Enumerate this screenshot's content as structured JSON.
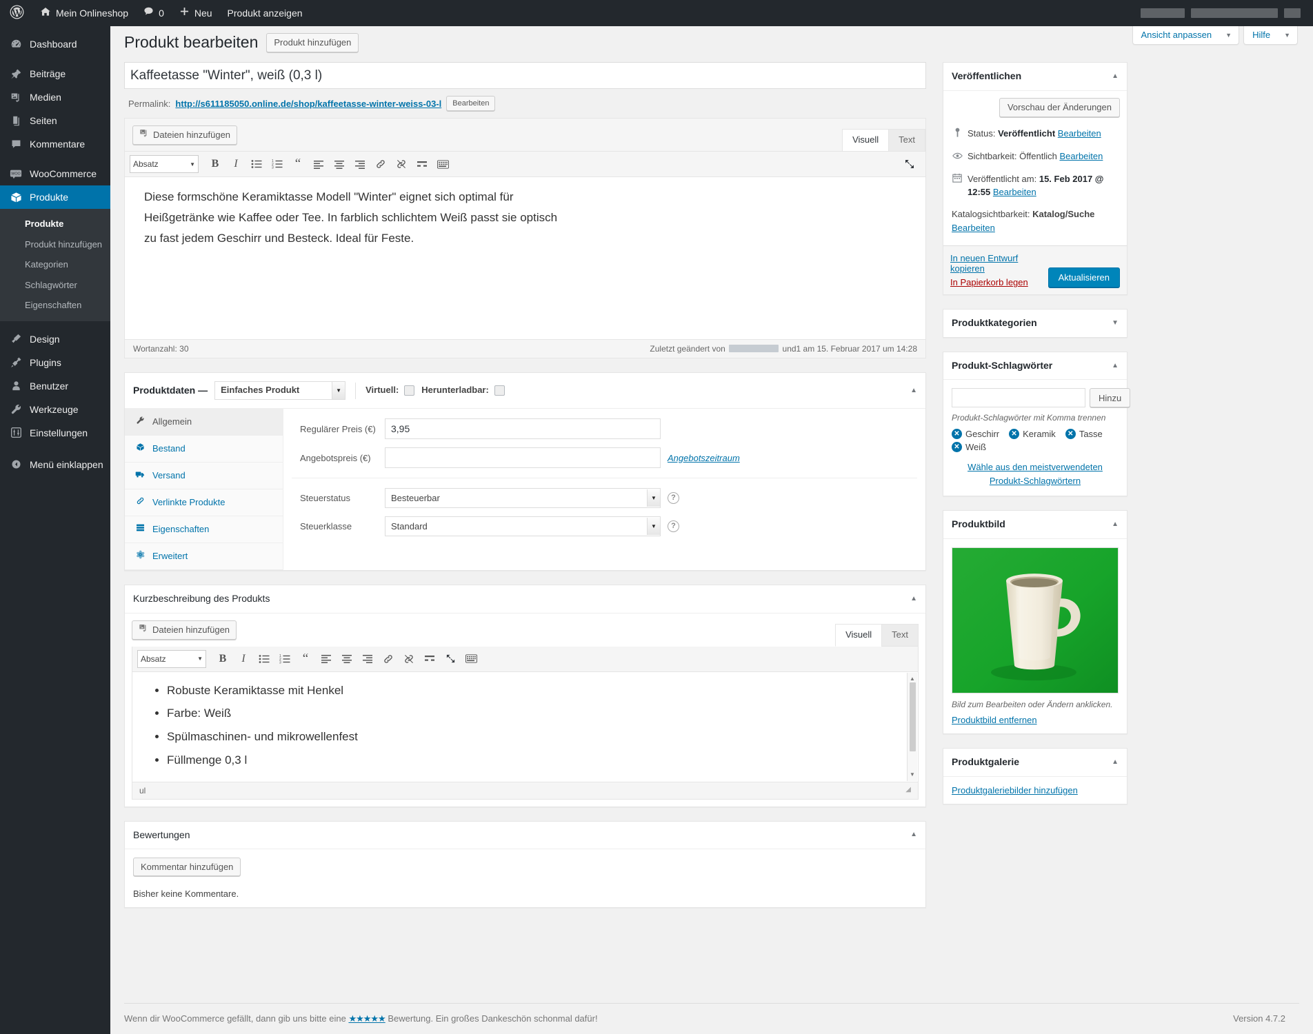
{
  "adminbar": {
    "logo_icon": "wordpress-logo-icon",
    "site_name": "Mein Onlineshop",
    "comments_count": "0",
    "new_label": "Neu",
    "view_product_label": "Produkt anzeigen"
  },
  "sidebar": {
    "items": [
      {
        "label": "Dashboard",
        "icon": "dashboard-icon",
        "current": false
      },
      {
        "label": "Beiträge",
        "icon": "pin-icon",
        "current": false
      },
      {
        "label": "Medien",
        "icon": "media-icon",
        "current": false
      },
      {
        "label": "Seiten",
        "icon": "pages-icon",
        "current": false
      },
      {
        "label": "Kommentare",
        "icon": "comment-icon",
        "current": false
      },
      {
        "label": "WooCommerce",
        "icon": "woocommerce-icon",
        "current": false
      },
      {
        "label": "Produkte",
        "icon": "products-box-icon",
        "current": true
      },
      {
        "label": "Design",
        "icon": "paintbrush-icon",
        "current": false
      },
      {
        "label": "Plugins",
        "icon": "plug-icon",
        "current": false
      },
      {
        "label": "Benutzer",
        "icon": "user-icon",
        "current": false
      },
      {
        "label": "Werkzeuge",
        "icon": "wrench-icon",
        "current": false
      },
      {
        "label": "Einstellungen",
        "icon": "settings-sliders-icon",
        "current": false
      }
    ],
    "submenu": [
      {
        "label": "Produkte",
        "current": true
      },
      {
        "label": "Produkt hinzufügen",
        "current": false
      },
      {
        "label": "Kategorien",
        "current": false
      },
      {
        "label": "Schlagwörter",
        "current": false
      },
      {
        "label": "Eigenschaften",
        "current": false
      }
    ],
    "collapse_label": "Menü einklappen"
  },
  "screen_meta": {
    "customize_label": "Ansicht anpassen",
    "help_label": "Hilfe"
  },
  "header": {
    "page_title": "Produkt bearbeiten",
    "add_new_label": "Produkt hinzufügen"
  },
  "title_field": {
    "value": "Kaffeetasse \"Winter\", weiß (0,3 l)"
  },
  "permalink": {
    "label": "Permalink:",
    "url": "http://s611185050.online.de/shop/kaffeetasse-winter-weiss-03-l",
    "edit_label": "Bearbeiten"
  },
  "editor": {
    "add_media_label": "Dateien hinzufügen",
    "tab_visual": "Visuell",
    "tab_text": "Text",
    "format_select": "Absatz",
    "content": "Diese formschöne Keramiktasse Modell \"Winter\" eignet sich optimal für Heißgetränke wie Kaffee oder Tee. In farblich schlichtem Weiß passt sie optisch zu fast jedem Geschirr und Besteck. Ideal für Feste.",
    "word_count_label": "Wortanzahl: 30",
    "last_edited_prefix": "Zuletzt geändert von",
    "last_edited_mid": "und1 am",
    "last_edited_date": "15. Februar 2017 um 14:28"
  },
  "product_data": {
    "panel_label": "Produktdaten —",
    "type_value": "Einfaches Produkt",
    "virtual_label": "Virtuell:",
    "downloadable_label": "Herunterladbar:",
    "tabs": [
      {
        "label": "Allgemein",
        "icon": "wrench-icon",
        "active": true
      },
      {
        "label": "Bestand",
        "icon": "inventory-icon",
        "active": false
      },
      {
        "label": "Versand",
        "icon": "shipping-icon",
        "active": false
      },
      {
        "label": "Verlinkte Produkte",
        "icon": "link-icon",
        "active": false
      },
      {
        "label": "Eigenschaften",
        "icon": "attributes-icon",
        "active": false
      },
      {
        "label": "Erweitert",
        "icon": "gear-icon",
        "active": false
      }
    ],
    "fields": {
      "regular_price_label": "Regulärer Preis (€)",
      "regular_price_value": "3,95",
      "sale_price_label": "Angebotspreis (€)",
      "sale_price_value": "",
      "sale_schedule_link": "Angebotszeitraum",
      "tax_status_label": "Steuerstatus",
      "tax_status_value": "Besteuerbar",
      "tax_class_label": "Steuerklasse",
      "tax_class_value": "Standard",
      "help_glyph": "?"
    }
  },
  "short_description": {
    "title": "Kurzbeschreibung des Produkts",
    "add_media_label": "Dateien hinzufügen",
    "tab_visual": "Visuell",
    "tab_text": "Text",
    "format_select": "Absatz",
    "items": [
      "Robuste Keramiktasse mit Henkel",
      "Farbe: Weiß",
      "Spülmaschinen- und mikrowellenfest",
      "Füllmenge 0,3 l"
    ],
    "path_label": "ul"
  },
  "reviews": {
    "title": "Bewertungen",
    "add_comment_label": "Kommentar hinzufügen",
    "empty_label": "Bisher keine Kommentare."
  },
  "publish_box": {
    "title": "Veröffentlichen",
    "preview_label": "Vorschau der Änderungen",
    "status_label": "Status:",
    "status_value": "Veröffentlicht",
    "status_edit": "Bearbeiten",
    "visibility_label": "Sichtbarkeit:",
    "visibility_value": "Öffentlich",
    "visibility_edit": "Bearbeiten",
    "published_label": "Veröffentlicht am:",
    "published_value": "15. Feb 2017 @ 12:55",
    "published_edit": "Bearbeiten",
    "catalog_label": "Katalogsichtbarkeit:",
    "catalog_value": "Katalog/Suche",
    "catalog_edit": "Bearbeiten",
    "copy_draft_label": "In neuen Entwurf kopieren",
    "trash_label": "In Papierkorb legen",
    "update_label": "Aktualisieren"
  },
  "categories_box": {
    "title": "Produktkategorien"
  },
  "tags_box": {
    "title": "Produkt-Schlagwörter",
    "input_value": "",
    "add_label": "Hinzu",
    "hint": "Produkt-Schlagwörter mit Komma trennen",
    "tags": [
      "Geschirr",
      "Keramik",
      "Tasse",
      "Weiß"
    ],
    "cloud_link": "Wähle aus den meistverwendeten Produkt-Schlagwörtern"
  },
  "product_image_box": {
    "title": "Produktbild",
    "caption": "Bild zum Bearbeiten oder Ändern anklicken.",
    "remove_label": "Produktbild entfernen",
    "image_alt": "weiße Keramiktasse auf grünem Hintergrund",
    "background_color": "#1aa12c",
    "mug_color": "#f0ead6"
  },
  "product_gallery_box": {
    "title": "Produktgalerie",
    "add_link": "Produktgaleriebilder hinzufügen"
  },
  "footer": {
    "text_before": "Wenn dir WooCommerce gefällt, dann gib uns bitte eine",
    "stars": "★★★★★",
    "text_after": "Bewertung. Ein großes Dankeschön schonmal dafür!",
    "version": "Version 4.7.2"
  },
  "colors": {
    "admin_bg": "#23282d",
    "accent": "#0073aa",
    "primary_button": "#0085ba",
    "danger": "#a00"
  }
}
